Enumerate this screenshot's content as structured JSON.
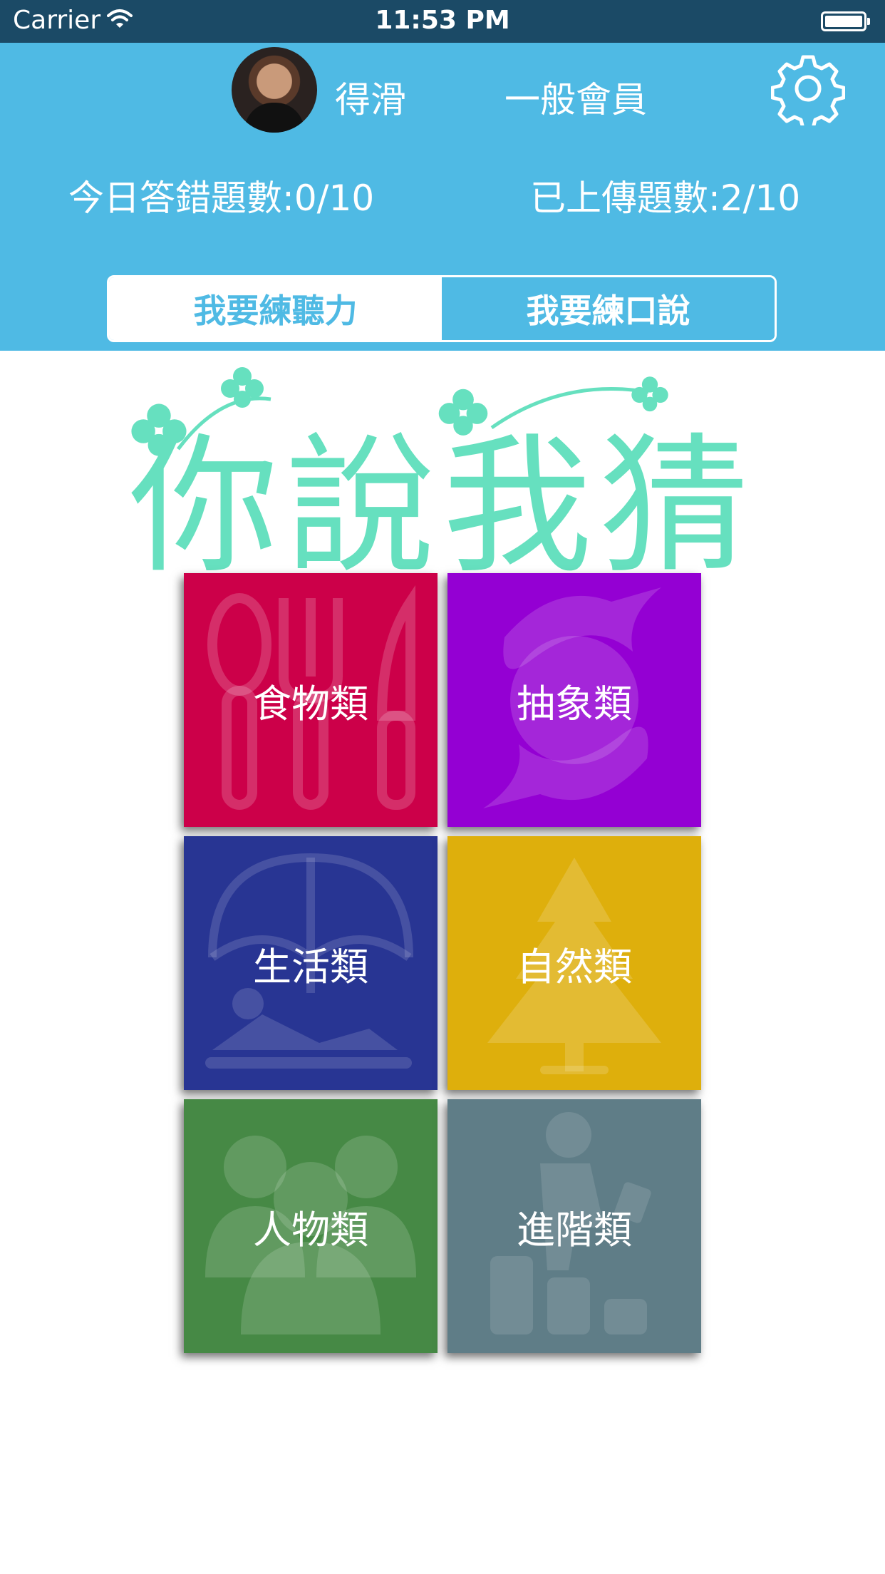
{
  "status_bar": {
    "carrier": "Carrier",
    "time": "11:53 PM"
  },
  "profile": {
    "username": "得滑",
    "membership": "一般會員"
  },
  "stats": {
    "wrong_today": "今日答錯題數:0/10",
    "uploaded": "已上傳題數:2/10"
  },
  "mode_tabs": [
    {
      "label": "我要練聽力",
      "selected": true
    },
    {
      "label": "我要練口說",
      "selected": false
    }
  ],
  "logo": {
    "text": "你說我猜",
    "color": "#66e0bf"
  },
  "categories": [
    {
      "label": "食物類",
      "color": "#cc0049",
      "icon": "utensils-icon"
    },
    {
      "label": "抽象類",
      "color": "#9400d3",
      "icon": "swirl-icon"
    },
    {
      "label": "生活類",
      "color": "#283593",
      "icon": "beach-umbrella-icon"
    },
    {
      "label": "自然類",
      "color": "#deaf0c",
      "icon": "tree-icon"
    },
    {
      "label": "人物類",
      "color": "#468945",
      "icon": "people-icon"
    },
    {
      "label": "進階類",
      "color": "#5f7d87",
      "icon": "climbing-steps-icon"
    }
  ],
  "colors": {
    "header": "#4fbae4",
    "status_bar": "#1b4a66"
  }
}
